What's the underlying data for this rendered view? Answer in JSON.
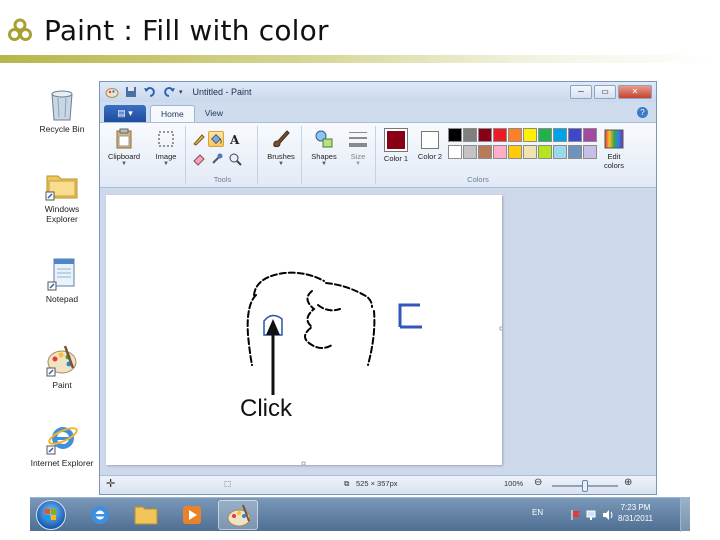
{
  "slide": {
    "title": "Paint : Fill with color"
  },
  "desktop": {
    "icons": [
      {
        "label": "Recycle Bin",
        "icon": "recycle-bin-icon"
      },
      {
        "label": "Windows Explorer",
        "icon": "folder-icon"
      },
      {
        "label": "Notepad",
        "icon": "notepad-icon"
      },
      {
        "label": "Paint",
        "icon": "paint-icon"
      },
      {
        "label": "Internet Explorer",
        "icon": "internet-explorer-icon"
      }
    ]
  },
  "window": {
    "title": "Untitled - Paint"
  },
  "tabs": {
    "home": "Home",
    "view": "View"
  },
  "ribbon": {
    "clipboard": "Clipboard",
    "image": "Image",
    "tools_caption": "Tools",
    "brushes": "Brushes",
    "shapes": "Shapes",
    "size": "Size",
    "color1": "Color 1",
    "color2": "Color 2",
    "colors_caption": "Colors",
    "edit_colors": "Edit colors"
  },
  "palette": [
    "#000000",
    "#7f7f7f",
    "#880015",
    "#ed1c24",
    "#ff7f27",
    "#fff200",
    "#22b14c",
    "#00a2e8",
    "#3f48cc",
    "#a349a4",
    "#ffffff",
    "#c3c3c3",
    "#b97a57",
    "#ffaec9",
    "#ffc90e",
    "#efe4b0",
    "#b5e61d",
    "#99d9ea",
    "#7092be",
    "#c8bfe7"
  ],
  "selected_color1": "#880015",
  "canvas": {
    "annotation": "Click"
  },
  "status": {
    "dimensions": "525 × 357px",
    "zoom": "100%"
  },
  "taskbar": {
    "language": "EN",
    "time": "7:23 PM",
    "date": "8/31/2011"
  }
}
